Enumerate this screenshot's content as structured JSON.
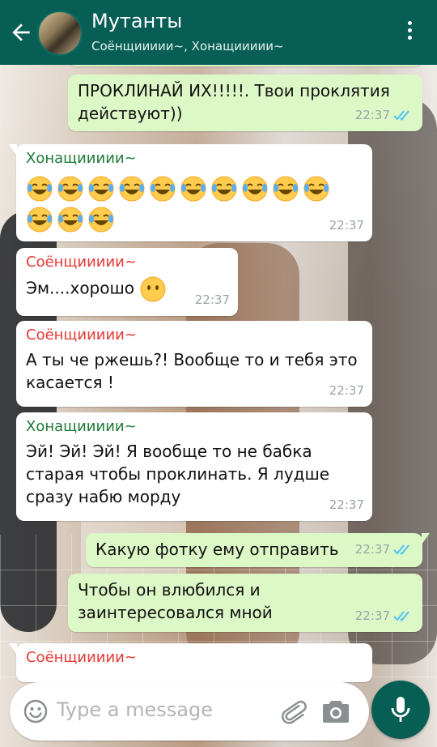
{
  "header": {
    "title": "Мутанты",
    "subtitle": "Соёнщиииии~, Хонащиииии~"
  },
  "messages": [
    {
      "type": "out",
      "text": "ПРОКЛИНАЙ ИХ!!!!!. Твои проклятия действуют))",
      "time": "22:37",
      "status": "read"
    },
    {
      "type": "in",
      "sender": "Хонащиииии~",
      "sender_color": "#1f7a3b",
      "emoji_count": 13,
      "emoji_name": "tears-of-joy-emoji",
      "time": "22:37"
    },
    {
      "type": "in",
      "sender": "Соёнщиииии~",
      "sender_color": "#e53935",
      "text": "Эм....хорошо",
      "emoji_name": "no-mouth-emoji",
      "time": "22:37"
    },
    {
      "type": "in",
      "sender": "Соёнщиииии~",
      "sender_color": "#e53935",
      "text": "А ты че ржешь?! Вообще то и тебя это касается !",
      "time": "22:37"
    },
    {
      "type": "in",
      "sender": "Хонащиииии~",
      "sender_color": "#1f7a3b",
      "text": "Эй! Эй! Эй! Я вообще то не бабка старая чтобы проклинать. Я лудше сразу набю морду",
      "time": "22:37"
    },
    {
      "type": "out",
      "text": "Какую фотку ему отправить",
      "time": "22:37",
      "status": "read"
    },
    {
      "type": "out",
      "text": "Чтобы он влюбился и заинтересовался мной",
      "time": "22:37",
      "status": "read"
    },
    {
      "type": "in",
      "sender": "Соёнщиииии~",
      "sender_color": "#e53935"
    }
  ],
  "input": {
    "placeholder": "Type a message"
  },
  "colors": {
    "header": "#075e54",
    "outgoing_bubble": "#dcf8c6",
    "incoming_bubble": "#ffffff",
    "read_ticks": "#4fc3f7"
  },
  "icons": [
    "back-arrow-icon",
    "menu-dots-icon",
    "smiley-icon",
    "attach-clip-icon",
    "camera-icon",
    "mic-icon",
    "double-check-icon"
  ]
}
